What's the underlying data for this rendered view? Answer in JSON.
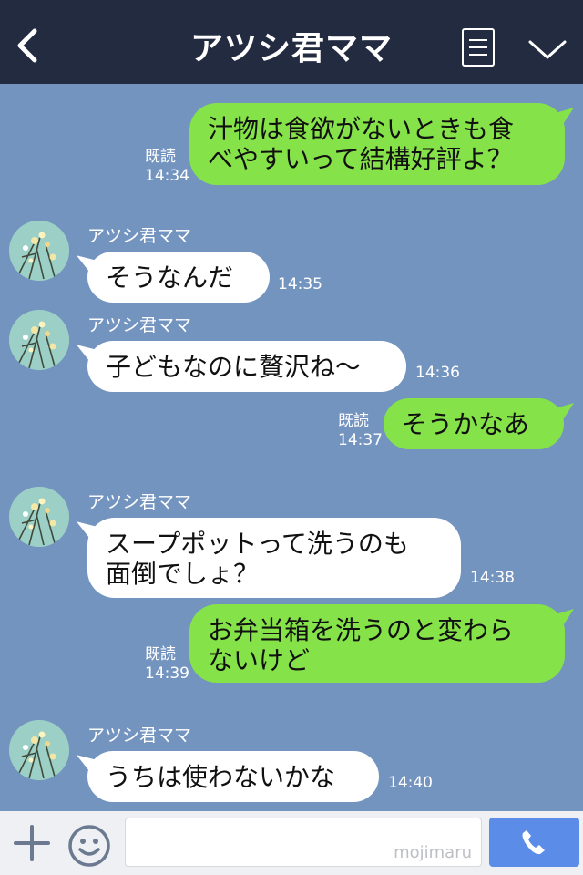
{
  "header": {
    "title": "アツシ君ママ"
  },
  "messages": [
    {
      "dir": "out",
      "lines": [
        "汁物は食欲がないときも食",
        "べやすいって結構好評よ？"
      ],
      "read": "既読",
      "time": "14:34"
    },
    {
      "dir": "in",
      "sender": "アツシ君ママ",
      "lines": [
        "そうなんだ"
      ],
      "time": "14:35"
    },
    {
      "dir": "in",
      "sender": "アツシ君ママ",
      "lines": [
        "子どもなのに贅沢ね〜"
      ],
      "time": "14:36"
    },
    {
      "dir": "out",
      "lines": [
        "そうかなあ"
      ],
      "read": "既読",
      "time": "14:37"
    },
    {
      "dir": "in",
      "sender": "アツシ君ママ",
      "lines": [
        "スープポットって洗うのも",
        "面倒でしょ？"
      ],
      "time": "14:38"
    },
    {
      "dir": "out",
      "lines": [
        "お弁当箱を洗うのと変わら",
        "ないけど"
      ],
      "read": "既読",
      "time": "14:39"
    },
    {
      "dir": "in",
      "sender": "アツシ君ママ",
      "lines": [
        "うちは使わないかな"
      ],
      "time": "14:40"
    }
  ],
  "footer": {
    "input_value": "",
    "watermark": "mojimaru"
  },
  "colors": {
    "header_bg": "#232b40",
    "chat_bg": "#7494c0",
    "outgoing_bubble": "#85e249",
    "incoming_bubble": "#ffffff",
    "call_button": "#5b8de8"
  },
  "icons": {
    "back": "chevron-left-icon",
    "menu": "list-icon",
    "collapse": "chevron-down-icon",
    "plus": "plus-icon",
    "emoji": "smiley-icon",
    "call": "phone-icon"
  }
}
